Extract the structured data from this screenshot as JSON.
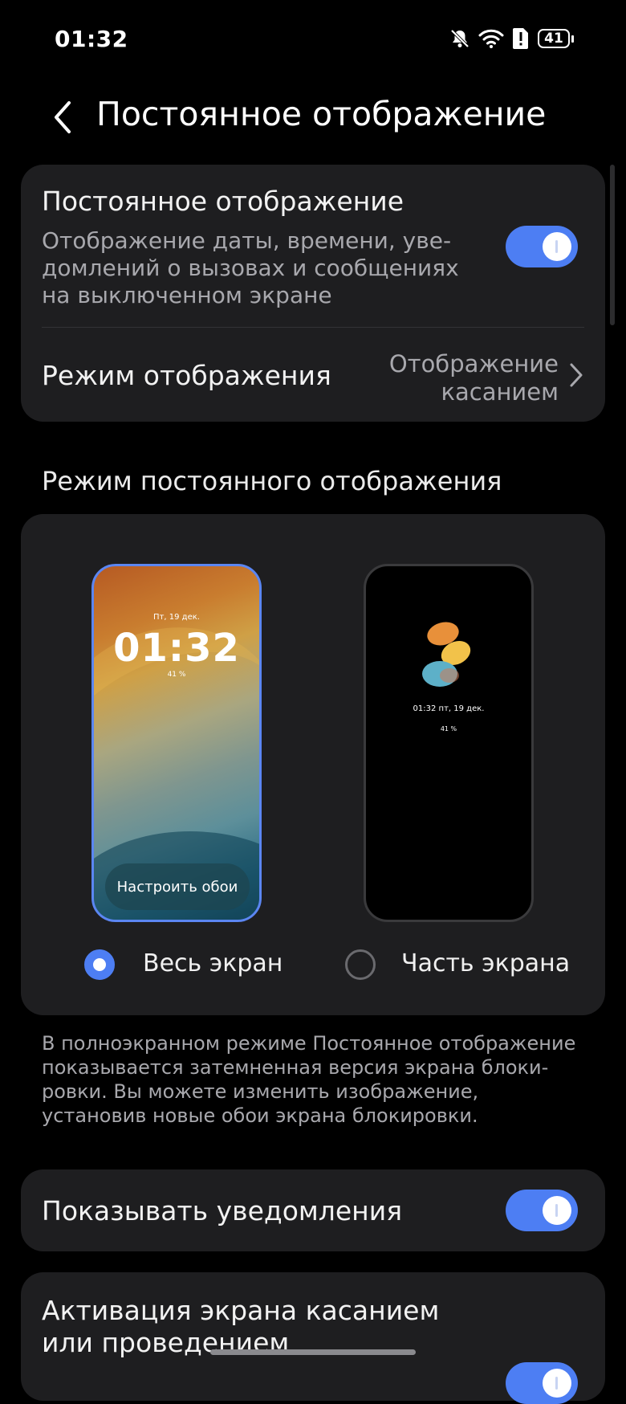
{
  "status": {
    "time": "01:32",
    "battery": "41"
  },
  "header": {
    "title": "Постоянное отображение"
  },
  "aod": {
    "title": "Постоянное отображение",
    "description": "Отображение даты, времени, уве-\nдомлений о вызовах и сообщениях\nна выключенном экране",
    "enabled": true
  },
  "display_mode": {
    "label": "Режим отображения",
    "value": "Отображение\nкасанием"
  },
  "section": {
    "title": "Режим постоянного отображения"
  },
  "preview_full": {
    "date": "Пт, 19 дек.",
    "time": "01:32",
    "battery": "41 %",
    "button": "Настроить обои"
  },
  "preview_part": {
    "time": "01:32  пт, 19 дек.",
    "battery": "41 %"
  },
  "options": [
    {
      "label": "Весь экран",
      "selected": true
    },
    {
      "label": "Часть экрана",
      "selected": false
    }
  ],
  "note": "В полноэкранном режиме Постоянное отображение показывается затемненная версия экрана блоки-ровки. Вы можете изменить изображение, установив новые обои экрана блокировки.",
  "show_notifications": {
    "label": "Показывать уведомления",
    "enabled": true
  },
  "tap_wake": {
    "label": "Активация экрана касанием\nили проведением",
    "enabled": true
  },
  "colors": {
    "accent": "#4d7ef3",
    "card": "#1e1e20",
    "background": "#000000"
  }
}
